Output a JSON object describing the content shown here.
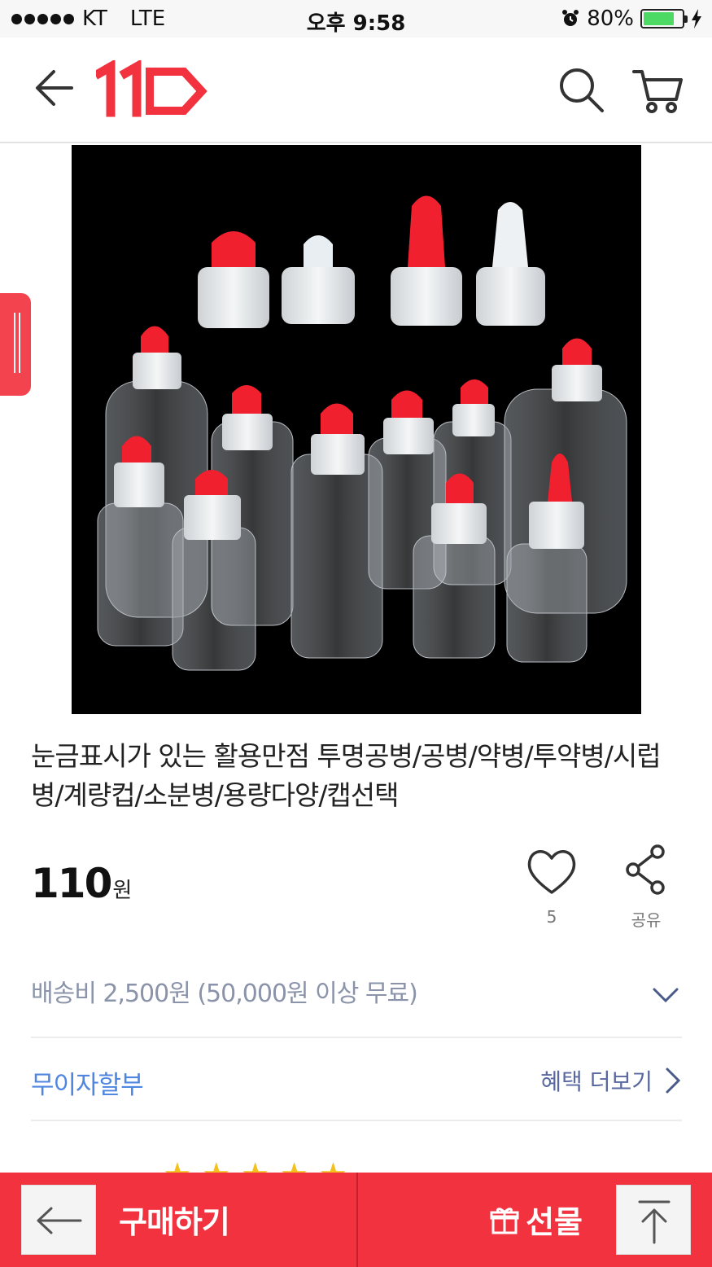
{
  "status_bar": {
    "carrier": "KT",
    "network": "LTE",
    "time": "오후 9:58",
    "battery": "80%"
  },
  "header": {
    "logo_text": "11",
    "icons": [
      "back-arrow-icon",
      "logo-11st",
      "search-icon",
      "cart-icon"
    ]
  },
  "product": {
    "image_alt": "transparent bottles with red and white caps",
    "title": "눈금표시가 있는 활용만점 투명공병/공병/약병/투약병/시럽병/계량컵/소분병/용량다양/캡선택",
    "price": "110",
    "price_unit": "원",
    "likes": "5",
    "share_label": "공유"
  },
  "shipping": {
    "text": "배송비 2,500원 (50,000원 이상 무료)"
  },
  "installment": {
    "label": "무이자할부",
    "more_label": "혜택 더보기"
  },
  "bottom_bar": {
    "buy_label": "구매하기",
    "gift_label": "선물"
  },
  "colors": {
    "brand_red": "#f2323f",
    "installment_blue": "#4f86e0",
    "shipping_gray": "#8a93a9"
  }
}
